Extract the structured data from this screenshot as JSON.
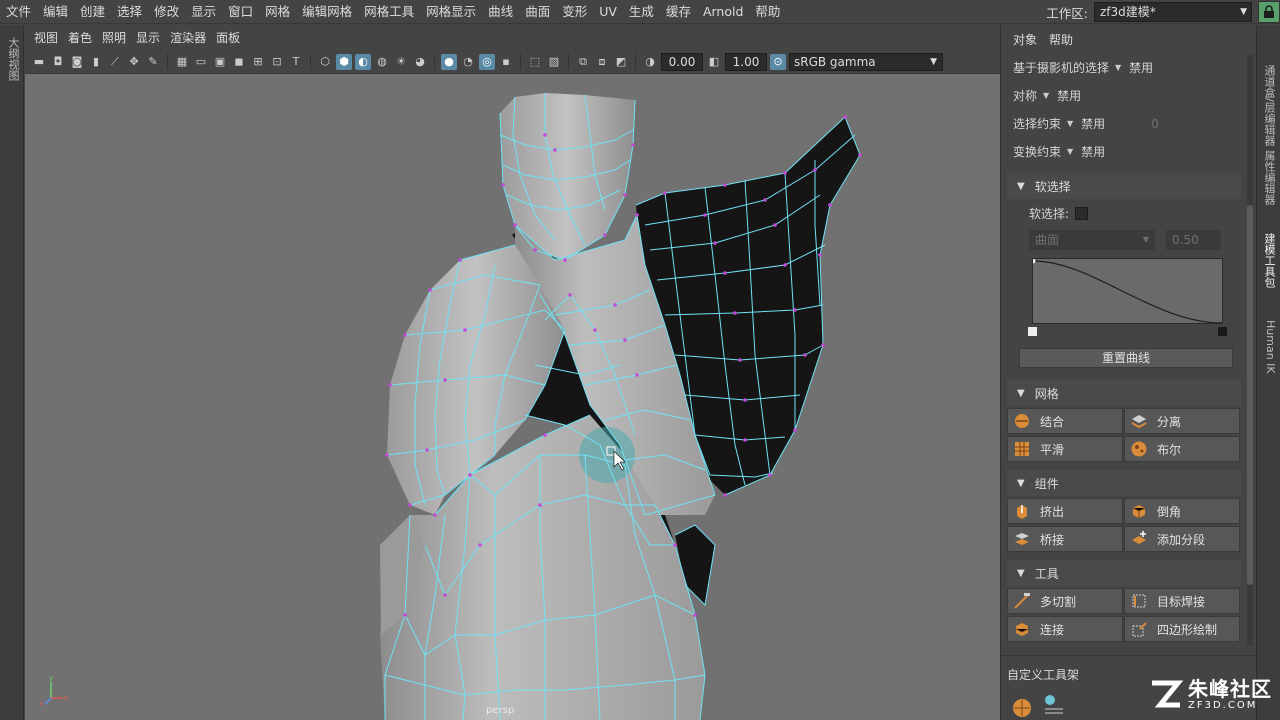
{
  "menubar": {
    "items": [
      "文件",
      "编辑",
      "创建",
      "选择",
      "修改",
      "显示",
      "窗口",
      "网格",
      "编辑网格",
      "网格工具",
      "网格显示",
      "曲线",
      "曲面",
      "变形",
      "UV",
      "生成",
      "缓存",
      "Arnold",
      "帮助"
    ],
    "workspace_label": "工作区:",
    "workspace_value": "zf3d建模*"
  },
  "left_strip": {
    "tab": "大纲视图"
  },
  "viewport": {
    "menu": [
      "视图",
      "着色",
      "照明",
      "显示",
      "渲染器",
      "面板"
    ],
    "toolbar": {
      "exposure": "0.00",
      "gamma": "1.00",
      "color_space": "sRGB gamma"
    },
    "camera_label": "persp"
  },
  "right_panel": {
    "menu": [
      "对象",
      "帮助"
    ],
    "rows": {
      "camera_select_label": "基于摄影机的选择",
      "camera_select_value": "禁用",
      "symmetry_label": "对称",
      "symmetry_value": "禁用",
      "select_constraint_label": "选择约束",
      "select_constraint_value": "禁用",
      "select_constraint_num": "0",
      "transform_constraint_label": "变换约束",
      "transform_constraint_value": "禁用"
    },
    "soft_select": {
      "header": "软选择",
      "checkbox_label": "软选择:",
      "mode": "曲面",
      "radius": "0.50",
      "reset_label": "重置曲线"
    },
    "mesh": {
      "header": "网格",
      "buttons": [
        "结合",
        "分离",
        "平滑",
        "布尔"
      ]
    },
    "components": {
      "header": "组件",
      "buttons": [
        "挤出",
        "倒角",
        "桥接",
        "添加分段"
      ]
    },
    "tools": {
      "header": "工具",
      "buttons": [
        "多切割",
        "目标焊接",
        "连接",
        "四边形绘制"
      ]
    },
    "custom_shelf": "自定义工具架"
  },
  "right_strip": {
    "tabs": [
      "通道盒/层编辑器",
      "属性编辑器",
      "建模工具包",
      "Human IK"
    ]
  },
  "watermark": {
    "cn": "朱峰社区",
    "en": "ZF3D.COM"
  },
  "colors": {
    "wire": "#6fe3f4",
    "vertex": "#c24bd6",
    "mesh_light": "#a9a9a9",
    "backface": "#151515",
    "viewport_bg": "#717171",
    "lock": "#58a06c"
  }
}
